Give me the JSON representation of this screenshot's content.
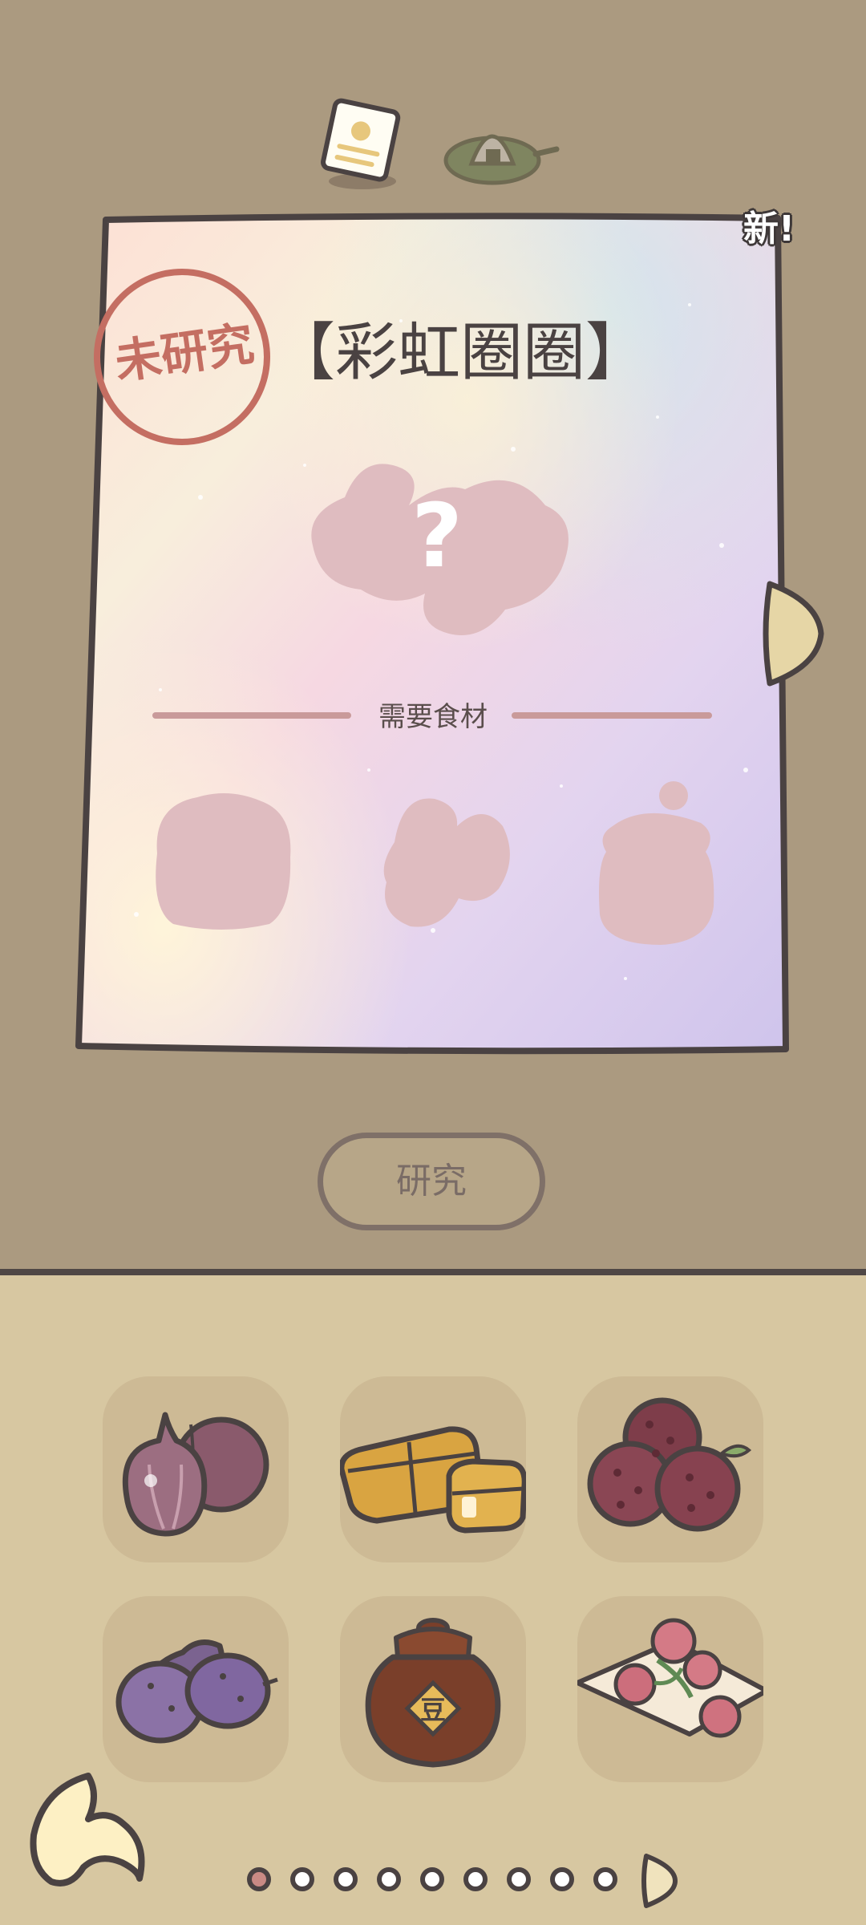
{
  "recipe": {
    "title": "【彩虹圈圈】",
    "status_stamp": "未研究",
    "new_badge": "新!",
    "unknown_mark": "?",
    "ingredients_label": "需要食材"
  },
  "actions": {
    "research_label": "研究"
  },
  "tabs": [
    {
      "icon": "recipe-note-icon",
      "active": true
    },
    {
      "icon": "onigiri-plate-icon",
      "active": false
    }
  ],
  "ingredients_inventory": [
    {
      "icon": "red-onion-icon"
    },
    {
      "icon": "tofu-blocks-icon"
    },
    {
      "icon": "bayberry-icon"
    },
    {
      "icon": "purple-sweet-potato-icon"
    },
    {
      "icon": "bean-paste-jar-icon"
    },
    {
      "icon": "rose-petals-icon"
    }
  ],
  "pagination": {
    "page_count": 9,
    "current_page": 1
  },
  "colors": {
    "background_top": "#ab9a80",
    "background_bottom": "#d7c7a1",
    "outline": "#4a4242",
    "stamp": "#c46e62",
    "silhouette": "#dfbcc0"
  }
}
